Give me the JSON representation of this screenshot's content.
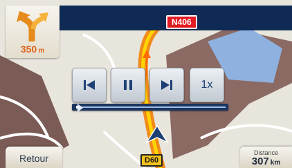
{
  "top_bar": {
    "road_number": "N406"
  },
  "turn": {
    "distance_value": "350",
    "distance_unit": "m",
    "icon": "turn-arrow-icon"
  },
  "playback": {
    "speed_label": "1x",
    "progress": 0.02,
    "buttons": [
      "previous-icon",
      "pause-icon",
      "next-icon"
    ]
  },
  "bottom": {
    "back_label": "Retour",
    "road_shield": "D60",
    "distance_label": "Distance",
    "distance_value": "307",
    "distance_unit": "km"
  },
  "colors": {
    "route": "#f08a1c",
    "route_highlight": "#ffd400",
    "top_bar": "#0f2b55",
    "turn_distance": "#e0641b",
    "shield_red": "#e31b23",
    "shield_yellow": "#f4c21a"
  }
}
